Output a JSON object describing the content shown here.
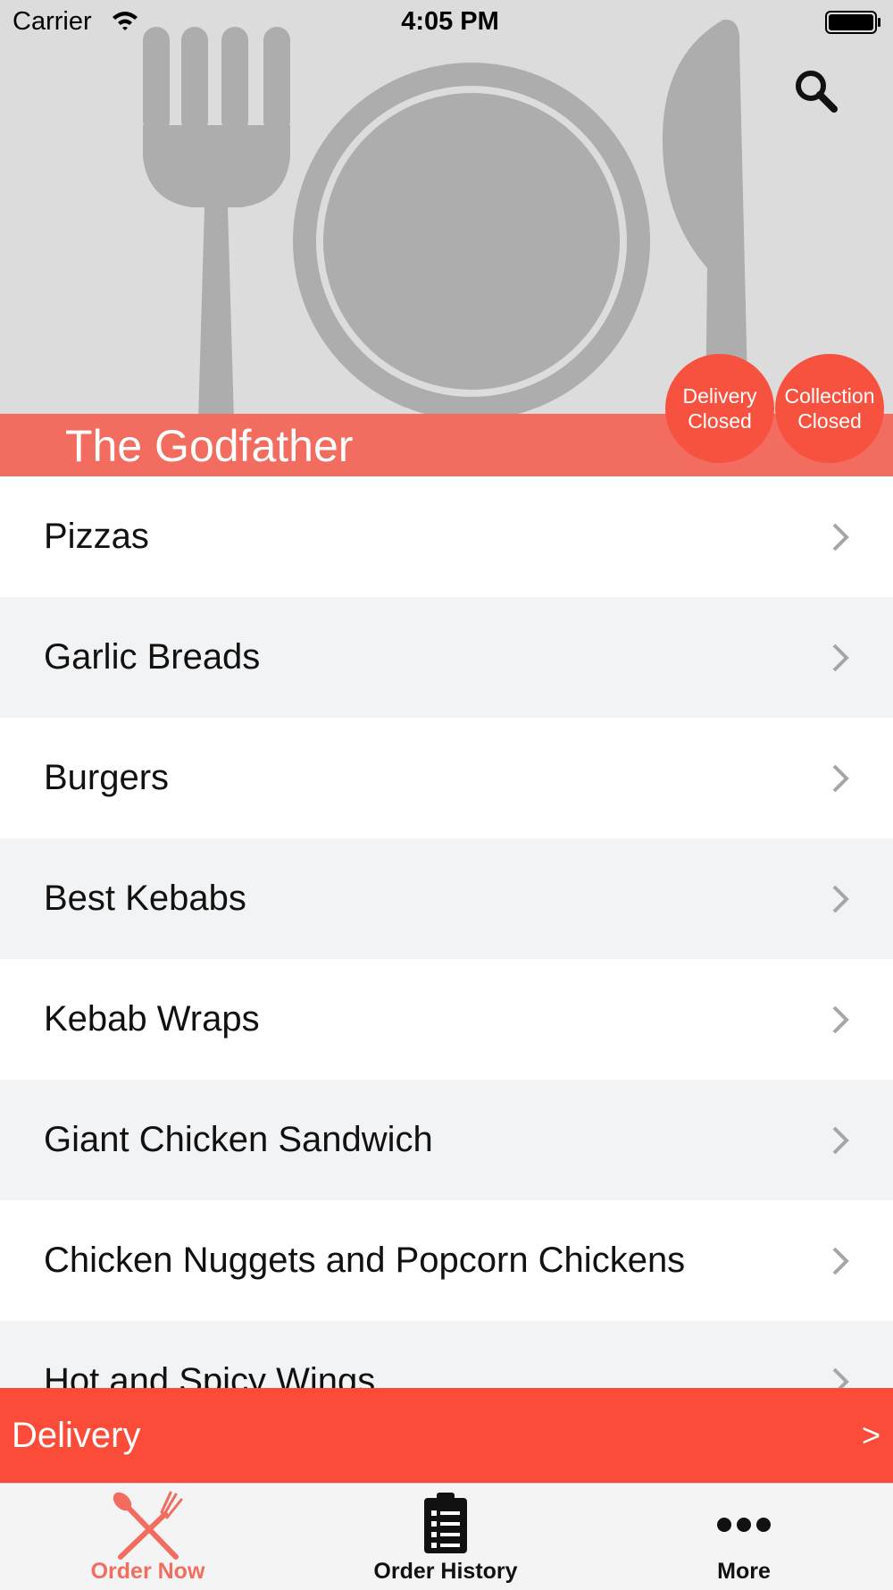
{
  "status_bar": {
    "carrier": "Carrier",
    "time": "4:05 PM"
  },
  "header": {
    "restaurant_name": "The Godfather",
    "delivery_status": [
      "Delivery",
      "Closed"
    ],
    "collection_status": [
      "Collection",
      "Closed"
    ],
    "search_icon": "search-icon"
  },
  "menu": {
    "categories": [
      "Pizzas",
      "Garlic Breads",
      "Burgers",
      "Best Kebabs",
      "Kebab Wraps",
      "Giant Chicken Sandwich",
      "Chicken Nuggets and Popcorn Chickens",
      "Hot and Spicy Wings"
    ]
  },
  "order_mode": {
    "label": "Delivery",
    "arrow": ">"
  },
  "tabs": [
    {
      "label": "Order Now",
      "icon": "fork-spoon-icon",
      "active": true
    },
    {
      "label": "Order History",
      "icon": "clipboard-icon",
      "active": false
    },
    {
      "label": "More",
      "icon": "more-dots-icon",
      "active": false
    }
  ],
  "colors": {
    "accent": "#fb4b39",
    "title_band": "#f26d5f",
    "active_tab": "#f26d5f"
  }
}
